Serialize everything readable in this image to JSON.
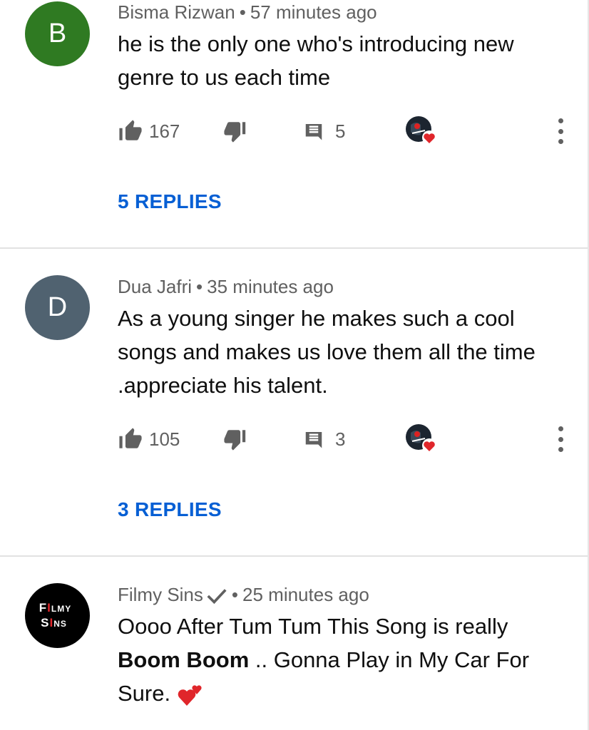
{
  "comments": [
    {
      "avatar_letter": "B",
      "author": "Bisma Rizwan",
      "separator": "•",
      "time": "57 minutes ago",
      "text": "he is the only one who's introducing new genre to us each time",
      "likes": "167",
      "replies_count": "5",
      "replies_label": "5 REPLIES"
    },
    {
      "avatar_letter": "D",
      "author": "Dua Jafri",
      "separator": "•",
      "time": "35 minutes ago",
      "text": "As a young singer he makes such a cool songs and makes us love them all the time .appreciate his talent.",
      "likes": "105",
      "replies_count": "3",
      "replies_label": "3 REPLIES"
    },
    {
      "avatar_text_line1": "FILMY",
      "avatar_text_line2": "SINS",
      "author": "Filmy Sins",
      "separator": "•",
      "time": "25 minutes ago",
      "text_part1": "Oooo After Tum Tum This Song is really",
      "text_bold": "Boom Boom",
      "text_part2": " .. Gonna Play in My Car For Sure.",
      "verified": true
    }
  ],
  "icons": {
    "like": "thumbs-up-icon",
    "dislike": "thumbs-down-icon",
    "reply": "comment-icon",
    "creator_heart": "creator-heart-icon",
    "more": "more-vert-icon",
    "verified": "check-icon",
    "emoji": "two-hearts-emoji"
  },
  "colors": {
    "link": "#065fd4",
    "meta": "#606060",
    "heart": "#e0262b"
  }
}
